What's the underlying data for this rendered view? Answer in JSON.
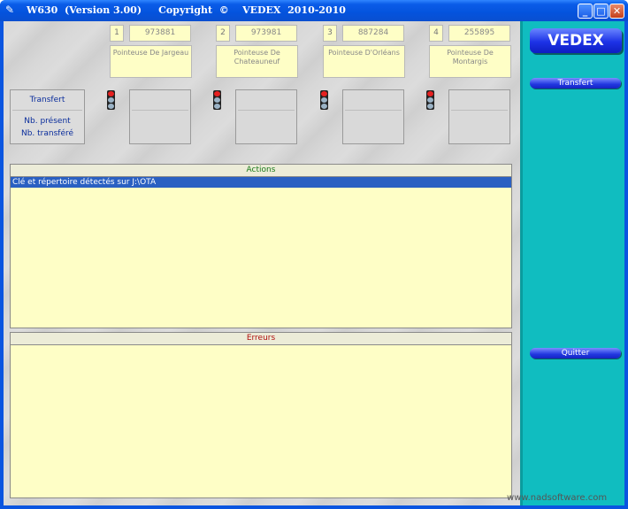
{
  "window": {
    "title": "W630  (Version 3.00)     Copyright  ©    VEDEX  2010-2010",
    "minimize": "_",
    "maximize": "□",
    "close": "✕"
  },
  "stations": [
    {
      "number": "1",
      "code": "973881",
      "name": "Pointeuse De Jargeau"
    },
    {
      "number": "2",
      "code": "973981",
      "name": "Pointeuse De Chateauneuf"
    },
    {
      "number": "3",
      "code": "887284",
      "name": "Pointeuse D'Orléans"
    },
    {
      "number": "4",
      "code": "255895",
      "name": "Pointeuse De Montargis"
    }
  ],
  "info": {
    "title": "Transfert",
    "present_label": "Nb. présent",
    "transferred_label": "Nb. transféré"
  },
  "actions": {
    "header": "Actions",
    "rows": [
      "Clé et répertoire détectés sur J:\\OTA"
    ]
  },
  "errors": {
    "header": "Erreurs"
  },
  "side": {
    "logo": "VEDEX",
    "transfer_button": "Transfert",
    "quit_button": "Quitter"
  },
  "watermark": "www.nadsoftware.com",
  "colors": {
    "titlebar": "#0a5ce8",
    "side_panel": "#10bdc0",
    "list_bg": "#fefec6",
    "selected_row": "#2a60c2",
    "actions_header_text": "#1a7a1a",
    "errors_header_text": "#b01010"
  }
}
